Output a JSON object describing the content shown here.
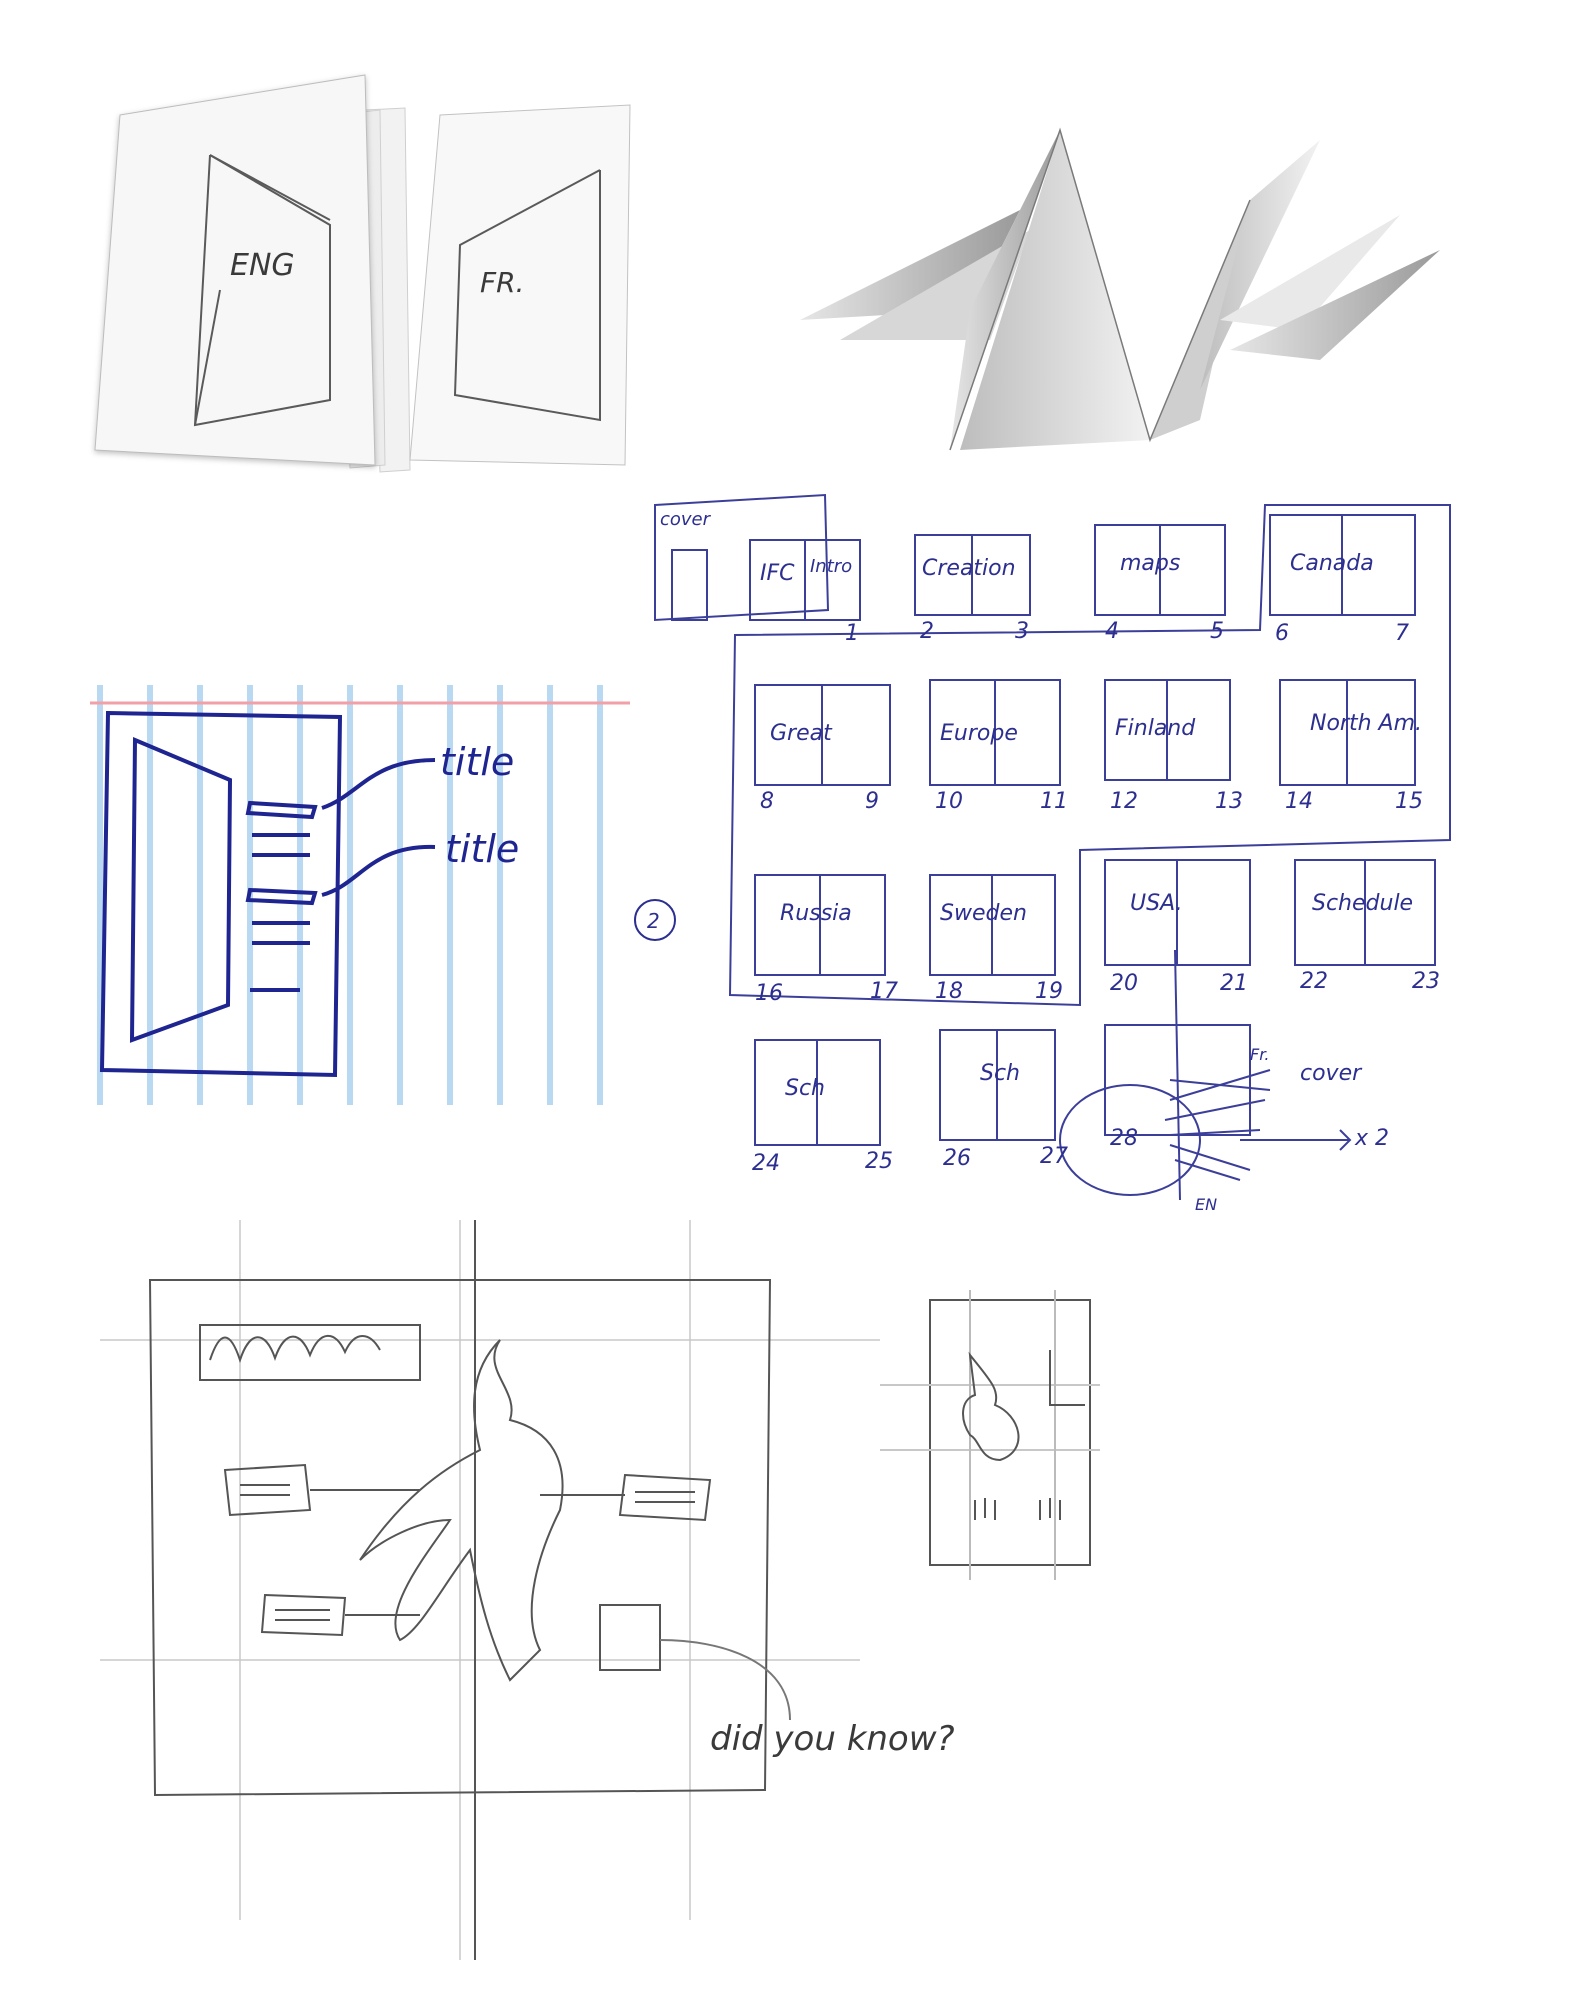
{
  "bilingual_booklet": {
    "left_cover_label": "ENG",
    "right_cover_label": "FR."
  },
  "layout_sketch": {
    "callout_1": "title",
    "callout_2": "title"
  },
  "flatplan": {
    "cover_label": "cover",
    "circled_mark": "2",
    "spreads": [
      {
        "title": "IFC",
        "title2": "Intro",
        "left_page": "",
        "right_page": "1"
      },
      {
        "title": "Creation",
        "left_page": "2",
        "right_page": "3"
      },
      {
        "title": "maps",
        "left_page": "4",
        "right_page": "5"
      },
      {
        "title": "Canada",
        "left_page": "6",
        "right_page": "7"
      },
      {
        "title": "Great",
        "left_page": "8",
        "right_page": "9"
      },
      {
        "title": "Europe",
        "left_page": "10",
        "right_page": "11"
      },
      {
        "title": "Finland",
        "left_page": "12",
        "right_page": "13"
      },
      {
        "title": "North Am.",
        "left_page": "14",
        "right_page": "15"
      },
      {
        "title": "Russia",
        "left_page": "16",
        "right_page": "17"
      },
      {
        "title": "Sweden",
        "left_page": "18",
        "right_page": "19"
      },
      {
        "title": "USA.",
        "left_page": "20",
        "right_page": "21"
      },
      {
        "title": "Schedule",
        "left_page": "22",
        "right_page": "23"
      },
      {
        "title": "Sch",
        "left_page": "24",
        "right_page": "25"
      },
      {
        "title": "Sch",
        "left_page": "26",
        "right_page": "27"
      },
      {
        "title": "",
        "left_page": "28",
        "right_page": ""
      }
    ],
    "back_cover_note": "Fr.",
    "cover_note": "cover",
    "multiplier_note": "x 2",
    "bottom_note": "EN"
  },
  "spread_sketch": {
    "annotation": "did you know?"
  }
}
